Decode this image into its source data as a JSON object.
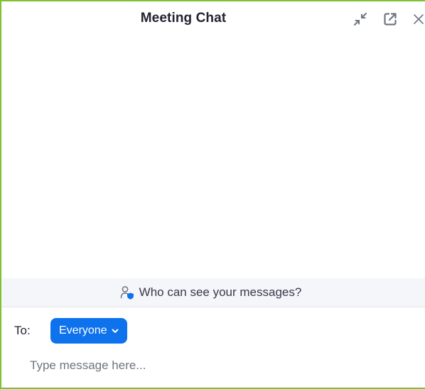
{
  "header": {
    "title": "Meeting Chat",
    "icons": [
      "collapse-icon",
      "pop-out-icon",
      "close-icon"
    ]
  },
  "visibility": {
    "text": "Who can see your messages?",
    "icon": "person-shield-icon"
  },
  "recipient": {
    "label": "To:",
    "value": "Everyone",
    "icon": "chevron-down-icon"
  },
  "composer": {
    "placeholder": "Type message here..."
  },
  "colors": {
    "accent": "#0e72ed",
    "window_border": "#7cc331",
    "bar_background": "#f5f6fa"
  }
}
